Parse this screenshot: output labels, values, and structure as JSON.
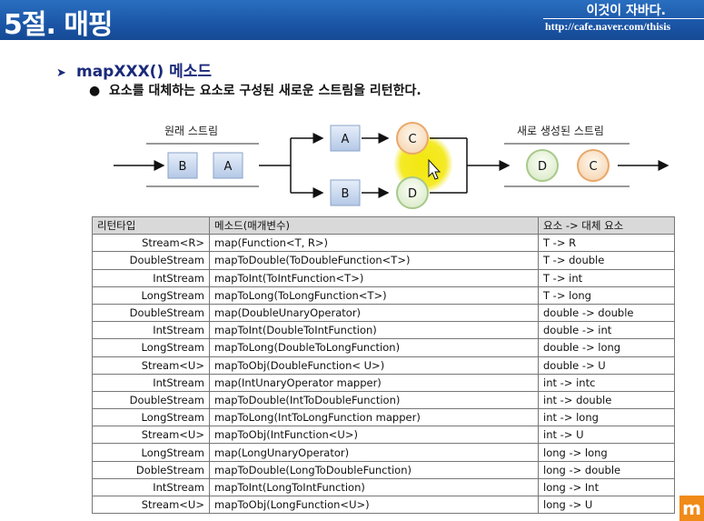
{
  "header": {
    "title": "5절. 매핑",
    "brand": "이것이 자바다.",
    "url": "http://cafe.naver.com/thisis"
  },
  "heading": {
    "text": "mapXXX() 메소드",
    "bullet": "요소를 대체하는 요소로 구성된 새로운 스트림을 리턴한다."
  },
  "diagram": {
    "source_label": "원래 스트림",
    "result_label": "새로 생성된 스트림",
    "input_items": [
      "B",
      "A"
    ],
    "branch_top": {
      "from": "A",
      "to": "C"
    },
    "branch_bottom": {
      "from": "B",
      "to": "D"
    },
    "output_items": [
      "D",
      "C"
    ]
  },
  "table": {
    "headers": [
      "리턴타입",
      "메소드(매개변수)",
      "요소 -> 대체 요소"
    ],
    "rows": [
      [
        "Stream<R>",
        "map(Function<T, R>)",
        "T -> R"
      ],
      [
        "DoubleStream",
        "mapToDouble(ToDoubleFunction<T>)",
        "T -> double"
      ],
      [
        "IntStream",
        "mapToInt(ToIntFunction<T>)",
        "T -> int"
      ],
      [
        "LongStream",
        "mapToLong(ToLongFunction<T>)",
        "T -> long"
      ],
      [
        "DoubleStream",
        "map(DoubleUnaryOperator)",
        "double -> double"
      ],
      [
        "IntStream",
        "mapToInt(DoubleToIntFunction)",
        "double -> int"
      ],
      [
        "LongStream",
        "mapToLong(DoubleToLongFunction)",
        "double -> long"
      ],
      [
        "Stream<U>",
        "mapToObj(DoubleFunction< U>)",
        "double -> U"
      ],
      [
        "IntStream",
        "map(IntUnaryOperator mapper)",
        "int -> intc"
      ],
      [
        "DoubleStream",
        "mapToDouble(IntToDoubleFunction)",
        "int -> double"
      ],
      [
        "LongStream",
        "mapToLong(IntToLongFunction mapper)",
        "int -> long"
      ],
      [
        "Stream<U>",
        "mapToObj(IntFunction<U>)",
        "int -> U"
      ],
      [
        "LongStream",
        "map(LongUnaryOperator)",
        "long -> long"
      ],
      [
        "DobleStream",
        "mapToDouble(LongToDoubleFunction)",
        "long -> double"
      ],
      [
        "IntStream",
        "mapToInt(LongToIntFunction)",
        "long -> Int"
      ],
      [
        "Stream<U>",
        "mapToObj(LongFunction<U>)",
        "long -> U"
      ]
    ]
  },
  "logo": {
    "text": "m"
  },
  "colors": {
    "header_bg": "#1b55a6",
    "heading_text": "#1a2a7a",
    "cursor_highlight": "#f2e600",
    "box_fill": "#c9d9ef",
    "circle_c_ring": "#e8a86a",
    "circle_d_ring": "#a7c98a",
    "logo_bg": "#f08a18"
  }
}
